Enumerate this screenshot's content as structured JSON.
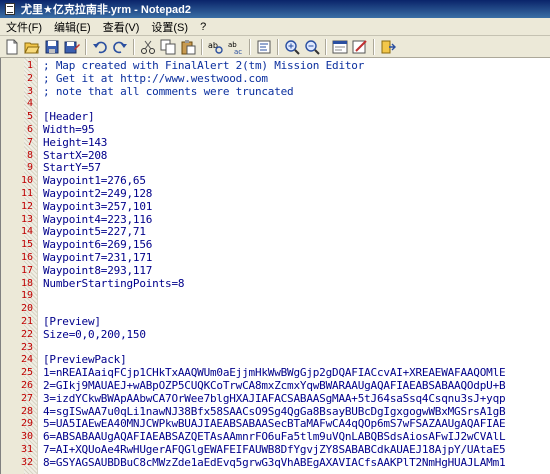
{
  "window": {
    "title": "尤里★亿克拉南非.yrm - Notepad2"
  },
  "menu": {
    "items": [
      "文件(F)",
      "编辑(E)",
      "查看(V)",
      "设置(S)",
      "?"
    ]
  },
  "toolbar": {
    "buttons": [
      "new-icon",
      "open-icon",
      "save-icon",
      "save-as-icon",
      "undo-icon",
      "redo-icon",
      "cut-icon",
      "copy-icon",
      "paste-icon",
      "find-icon",
      "replace-icon",
      "wordwrap-icon",
      "zoom-in-icon",
      "zoom-out-icon",
      "scheme-icon",
      "customize-icon",
      "exit-icon"
    ]
  },
  "editor": {
    "lines": [
      {
        "n": "1",
        "text": "; Map created with FinalAlert 2(tm) Mission Editor"
      },
      {
        "n": "2",
        "text": "; Get it at http://www.westwood.com"
      },
      {
        "n": "3",
        "text": "; note that all comments were truncated"
      },
      {
        "n": "4",
        "text": ""
      },
      {
        "n": "5",
        "text": "[Header]"
      },
      {
        "n": "6",
        "text": "Width=95"
      },
      {
        "n": "7",
        "text": "Height=143"
      },
      {
        "n": "8",
        "text": "StartX=208"
      },
      {
        "n": "9",
        "text": "StartY=57"
      },
      {
        "n": "10",
        "text": "Waypoint1=276,65"
      },
      {
        "n": "11",
        "text": "Waypoint2=249,128"
      },
      {
        "n": "12",
        "text": "Waypoint3=257,101"
      },
      {
        "n": "13",
        "text": "Waypoint4=223,116"
      },
      {
        "n": "14",
        "text": "Waypoint5=227,71"
      },
      {
        "n": "15",
        "text": "Waypoint6=269,156"
      },
      {
        "n": "16",
        "text": "Waypoint7=231,171"
      },
      {
        "n": "17",
        "text": "Waypoint8=293,117"
      },
      {
        "n": "18",
        "text": "NumberStartingPoints=8"
      },
      {
        "n": "19",
        "text": ""
      },
      {
        "n": "20",
        "text": ""
      },
      {
        "n": "21",
        "text": "[Preview]"
      },
      {
        "n": "22",
        "text": "Size=0,0,200,150"
      },
      {
        "n": "23",
        "text": ""
      },
      {
        "n": "24",
        "text": "[PreviewPack]"
      },
      {
        "n": "25",
        "text": "1=nREAIAaiqFCjp1CHkTxAAQWUm0aEjjmHkWwBWgGjp2gDQAFIACcvAI+XREAEWAFAAQOMlE"
      },
      {
        "n": "26",
        "text": "2=GIkj9MAUAEJ+wABpOZP5CUQKCoTrwCA8mxZcmxYqwBWARAAUgAQAFIAEABSABAAQOdpU+B"
      },
      {
        "n": "27",
        "text": "3=izdYCkwBWApAAbwCA7OrWee7blgHXAJIAFACSABAASgMAA+5tJ64saSsq4Csqnu3sJ+yqp"
      },
      {
        "n": "28",
        "text": "4=sgISwAA7u0qLi1nawNJ38Bfx58SAACsO9Sg4QgGa8BsayBUBcDgIgxgogwWBxMGSrsA1gB"
      },
      {
        "n": "29",
        "text": "5=UA5IAEwEA40MNJCWPkwBUAJIAEABSABAASecBTaMAFwCA4qQOp6mS7wFSAZAAUgAQAFIAE"
      },
      {
        "n": "30",
        "text": "6=ABSABAAUgAQAFIAEABSAZQETAsAAmnrFO6uFa5tlm9uVQnLABQBSdsAiosAFwIJ2wCVAlL"
      },
      {
        "n": "31",
        "text": "7=AI+XQUoAe4RwHUgerAFQGlgEWAFEIFAUWB8DfYgvjZY8SABABCdkAUAEJ18AjpY/UAtaE5"
      },
      {
        "n": "32",
        "text": "8=GSYAGSAUBDBuC8cMWzZde1aEdEvq5grwG3qVhABEgAXAVIACfsAAKPlT2NmHgHUAJLAMm1"
      }
    ]
  }
}
